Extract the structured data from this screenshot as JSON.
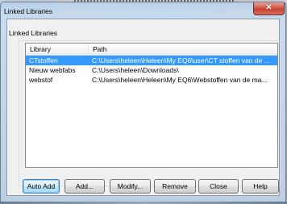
{
  "window": {
    "title": "Linked Libraries",
    "close_glyph": "✕"
  },
  "group": {
    "label": "Linked Libraries"
  },
  "list": {
    "columns": [
      "Library",
      "Path"
    ],
    "rows": [
      {
        "library": "CTstoffen",
        "path": "C:\\Users\\heleen\\Heleen\\My EQ6\\user\\CT stoffen van de ...",
        "selected": true
      },
      {
        "library": "Nieuw webfabs",
        "path": "C:\\Users\\heleen\\Downloads\\",
        "selected": false
      },
      {
        "library": "webstof",
        "path": "C:\\Users\\heleen\\Heleen\\My EQ6\\Webstoffen van de ma...",
        "selected": false
      }
    ]
  },
  "buttons": {
    "auto_add": "Auto Add",
    "add": "Add...",
    "modify": "Modify...",
    "remove": "Remove",
    "close": "Close",
    "help": "Help"
  },
  "colors": {
    "selection": "#3399ff",
    "close_button": "#c7402f"
  }
}
